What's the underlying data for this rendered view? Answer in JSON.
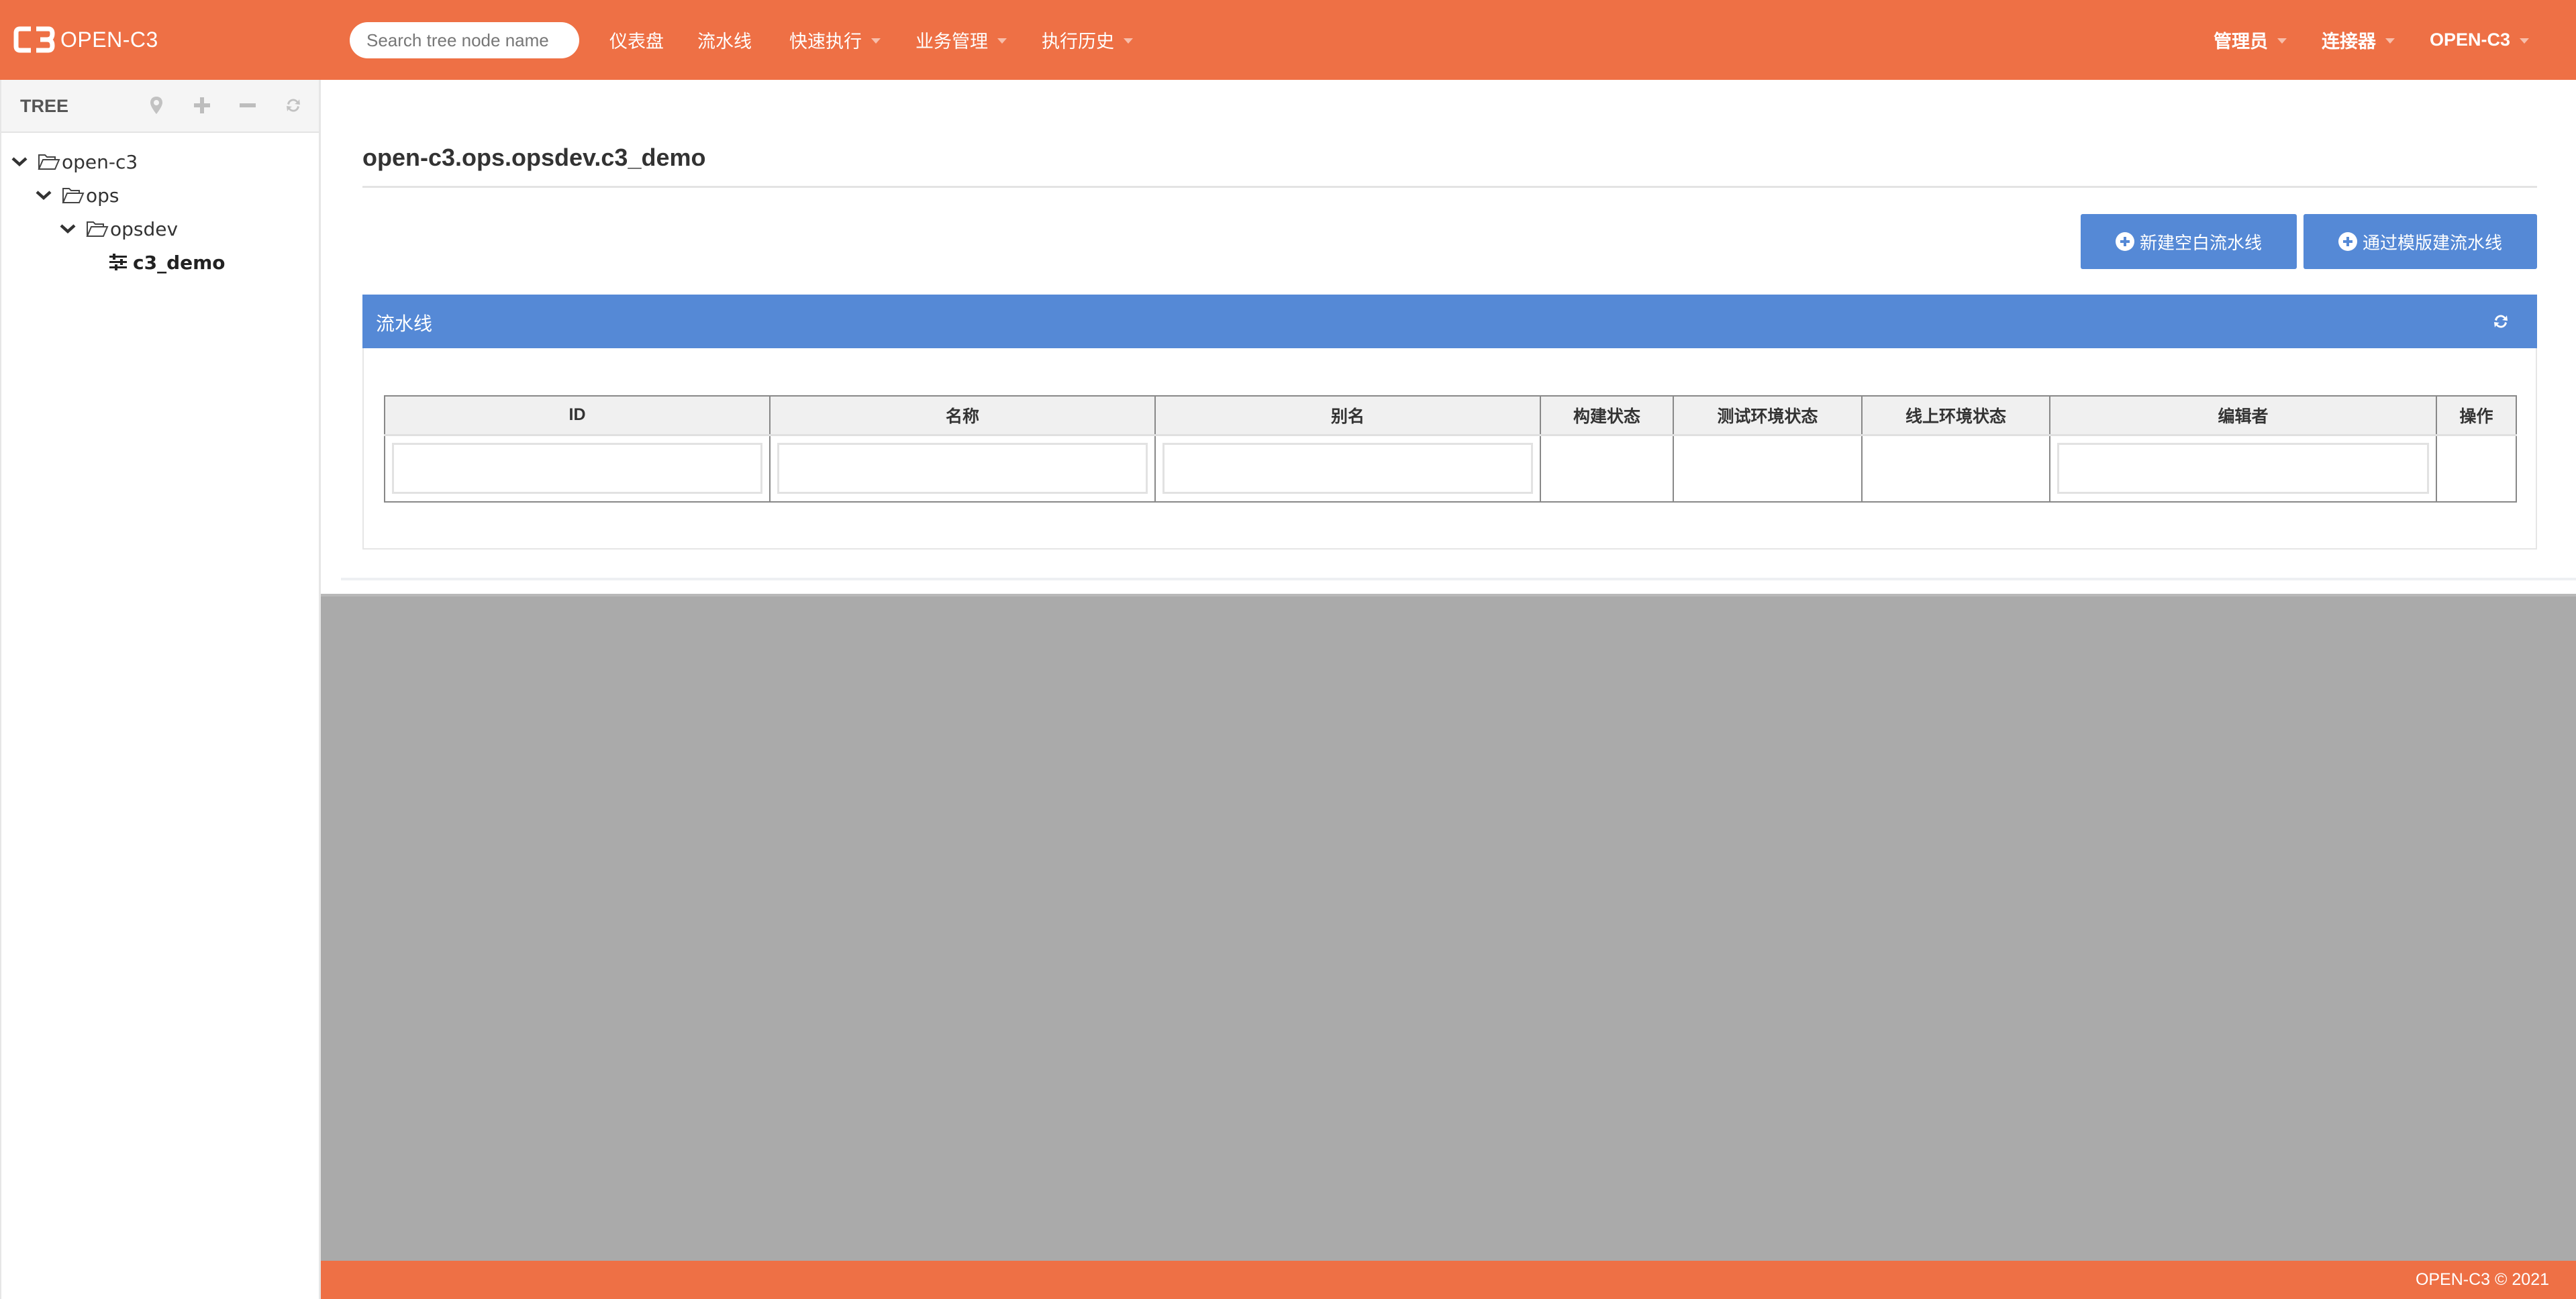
{
  "brand": {
    "name": "OPEN-C3",
    "accent_color": "#ee7045",
    "primary_color": "#5589d6"
  },
  "topbar": {
    "search_placeholder": "Search tree node name",
    "nav_left": [
      {
        "label": "仪表盘",
        "dropdown": false
      },
      {
        "label": "流水线",
        "dropdown": false
      },
      {
        "label": "快速执行",
        "dropdown": true
      },
      {
        "label": "业务管理",
        "dropdown": true
      },
      {
        "label": "执行历史",
        "dropdown": true
      }
    ],
    "nav_right": [
      {
        "label": "管理员",
        "dropdown": true
      },
      {
        "label": "连接器",
        "dropdown": true
      },
      {
        "label": "OPEN-C3",
        "dropdown": true
      }
    ]
  },
  "sidebar": {
    "title": "TREE",
    "tools": [
      {
        "icon": "map-marker-icon"
      },
      {
        "icon": "plus-icon"
      },
      {
        "icon": "minus-icon"
      },
      {
        "icon": "refresh-icon"
      }
    ],
    "tree": [
      {
        "label": "open-c3",
        "level": 0,
        "expanded": true,
        "type": "folder"
      },
      {
        "label": "ops",
        "level": 1,
        "expanded": true,
        "type": "folder"
      },
      {
        "label": "opsdev",
        "level": 2,
        "expanded": true,
        "type": "folder"
      },
      {
        "label": "c3_demo",
        "level": 3,
        "type": "leaf",
        "selected": true
      }
    ]
  },
  "main": {
    "page_title": "open-c3.ops.opsdev.c3_demo",
    "buttons": {
      "new_blank": "新建空白流水线",
      "from_template": "通过模版建流水线"
    },
    "panel": {
      "title": "流水线",
      "columns": [
        "ID",
        "名称",
        "别名",
        "构建状态",
        "测试环境状态",
        "线上环境状态",
        "编辑者",
        "操作"
      ],
      "filters": {
        "id": "",
        "name": "",
        "alias": "",
        "editor": ""
      },
      "rows": []
    }
  },
  "footer": {
    "text": "OPEN-C3 © 2021"
  }
}
